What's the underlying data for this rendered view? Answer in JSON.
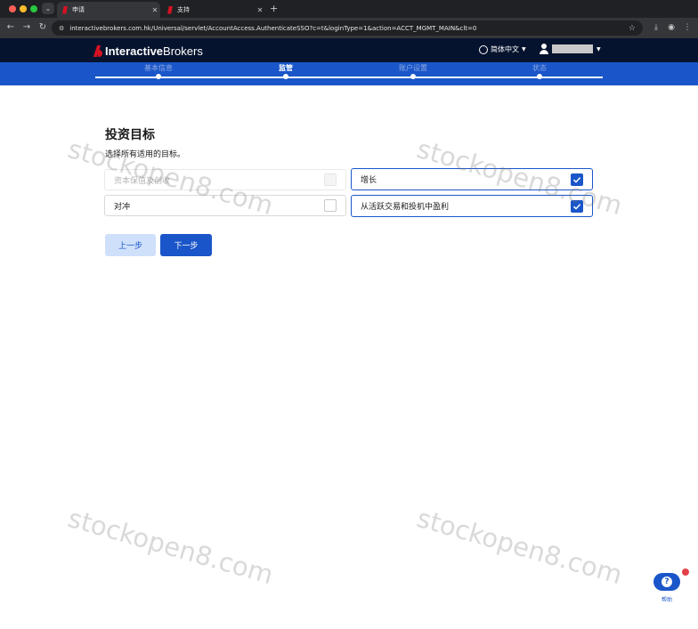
{
  "browser": {
    "tabs": [
      {
        "title": "申请",
        "active": true
      },
      {
        "title": "支持",
        "active": false
      }
    ],
    "url": "interactivebrokers.com.hk/Universal/servlet/AccountAccess.AuthenticateSSO?c=t&loginType=1&action=ACCT_MGMT_MAIN&clt=0"
  },
  "header": {
    "logo_bold": "Interactive",
    "logo_light": "Brokers",
    "language": "简体中文"
  },
  "stepper": {
    "steps": [
      {
        "label": "基本信息"
      },
      {
        "label": "监管"
      },
      {
        "label": "账户设置"
      },
      {
        "label": "状态"
      }
    ],
    "current_index": 1
  },
  "page": {
    "title": "投资目标",
    "subtitle": "选择所有适用的目标。",
    "options": [
      {
        "label": "资本保值及创收",
        "state": "disabled",
        "checked": false
      },
      {
        "label": "增长",
        "state": "enabled",
        "checked": true
      },
      {
        "label": "对冲",
        "state": "enabled",
        "checked": false
      },
      {
        "label": "从活跃交易和投机中盈利",
        "state": "enabled",
        "checked": true
      }
    ],
    "prev_button": "上一步",
    "next_button": "下一步"
  },
  "help": {
    "label": "帮助"
  },
  "watermark": "stockopen8.com",
  "colors": {
    "brand_blue": "#1a56c9",
    "header_navy": "#06132e",
    "logo_red": "#d81222"
  }
}
